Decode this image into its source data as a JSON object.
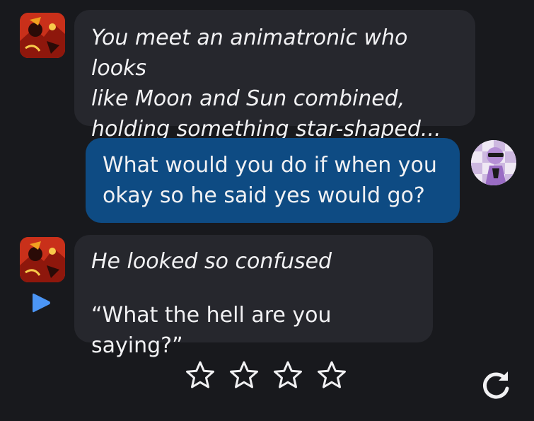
{
  "messages": [
    {
      "role": "bot",
      "lines": [
        "You meet an animatronic who looks",
        "like Moon and Sun combined,",
        "holding something star-shaped..."
      ]
    },
    {
      "role": "user",
      "lines": [
        "What would you do if when you",
        "okay so he said yes would go?"
      ]
    },
    {
      "role": "bot",
      "action": "He looked so confused",
      "speech": "“What the hell are you saying?”"
    }
  ],
  "rating": {
    "stars_total": 4,
    "stars_filled": 0
  },
  "icons": {
    "play": "play-icon",
    "star": "star-outline-icon",
    "regenerate": "refresh-icon"
  },
  "colors": {
    "background": "#18191d",
    "bot_bubble": "#26272d",
    "user_bubble": "#0e4b83",
    "play_icon": "#4b95f5"
  }
}
